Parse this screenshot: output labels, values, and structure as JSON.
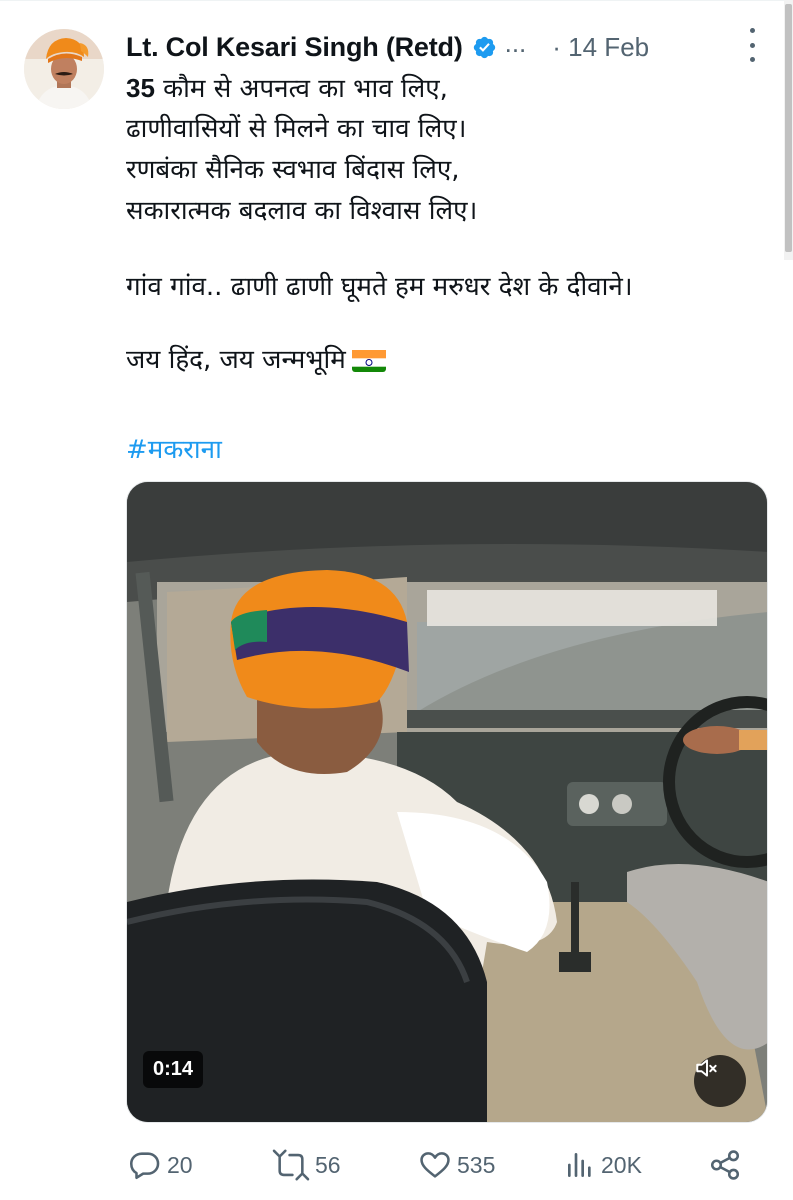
{
  "tweet": {
    "author": {
      "display_name": "Lt. Col Kesari Singh (Retd)",
      "verified_icon": "verified-badge-icon",
      "ellipsis": "...",
      "date": "· 14 Feb"
    },
    "text_lines": [
      {
        "bold": "35",
        "rest": " कौम से अपनत्व का भाव लिए,"
      },
      "ढाणीवासियों से मिलने का चाव लिए।",
      "रणबंका सैनिक स्वभाव बिंदास लिए,",
      "सकारात्मक बदलाव का विश्वास लिए।",
      "गांव गांव.. ढाणी ढाणी घूमते हम मरुधर देश के दीवाने।",
      "जय हिंद, जय जन्मभूमि"
    ],
    "flag_emoji": "🇮🇳",
    "hashtag": "#मकराना",
    "media": {
      "type": "video",
      "duration": "0:14",
      "volume_icon": "muted-speaker-icon"
    },
    "actions": {
      "replies": "20",
      "retweets": "56",
      "likes": "535",
      "views": "20K",
      "share_icon": "share-icon"
    }
  },
  "colors": {
    "text": "#0f1419",
    "secondary": "#536471",
    "accent": "#1d9bf0"
  }
}
